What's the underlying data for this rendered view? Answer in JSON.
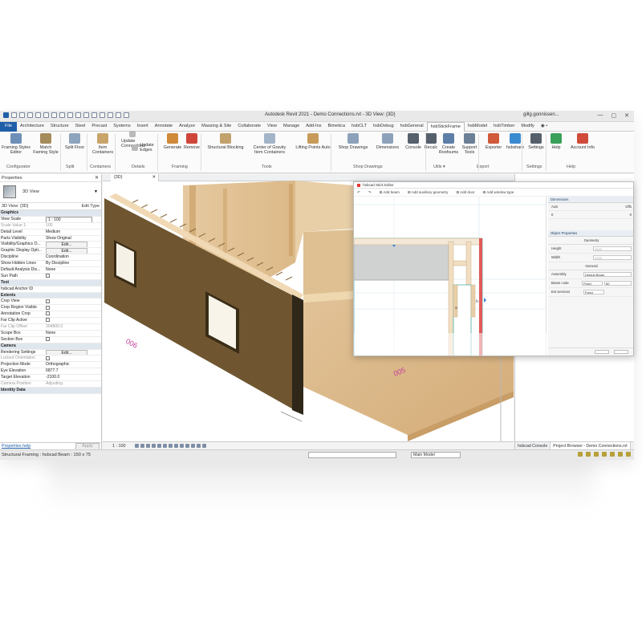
{
  "app": {
    "title": "Autodesk Revit 2021 - Demo Connections.rvt - 3D View: {3D}",
    "user": "gillg.gonnissen...",
    "window_buttons": [
      "—",
      "▢",
      "✕"
    ]
  },
  "ribbon_tabs": [
    {
      "label": "File",
      "state": "file"
    },
    {
      "label": "Architecture"
    },
    {
      "label": "Structure"
    },
    {
      "label": "Steel"
    },
    {
      "label": "Precast"
    },
    {
      "label": "Systems"
    },
    {
      "label": "Insert"
    },
    {
      "label": "Annotate"
    },
    {
      "label": "Analyze"
    },
    {
      "label": "Massing & Site"
    },
    {
      "label": "Collaborate"
    },
    {
      "label": "View"
    },
    {
      "label": "Manage"
    },
    {
      "label": "Add-Ins"
    },
    {
      "label": "Bimetica"
    },
    {
      "label": "hsbCLT"
    },
    {
      "label": "hsbDebug"
    },
    {
      "label": "hsbGeneral"
    },
    {
      "label": "hsbStickFrame",
      "state": "active"
    },
    {
      "label": "hsbModel"
    },
    {
      "label": "hsbTimber"
    },
    {
      "label": "Modify"
    },
    {
      "label": "◉ •"
    }
  ],
  "ribbon": {
    "buttons": [
      {
        "label": "Framing Styles\nEditor",
        "icon": "framing-styles-icon",
        "color": "#6d8fb8"
      },
      {
        "label": "Match\nFaming Style",
        "icon": "match-style-icon",
        "color": "#a58a5a"
      },
      {
        "label": "Split Floor",
        "icon": "split-floor-icon",
        "color": "#8ea4bd"
      },
      {
        "label": "Item\nContainers",
        "icon": "item-containers-icon",
        "color": "#c9a46a"
      },
      {
        "label": "Update\nConnections",
        "icon": "update-connections-icon",
        "color": "#b9b9b9"
      },
      {
        "label": "Update\nEdges",
        "icon": "update-edges-icon",
        "color": "#b9b9b9"
      },
      {
        "label": "Generate",
        "icon": "generate-icon",
        "color": "#d08a3a"
      },
      {
        "label": "Remove",
        "icon": "remove-icon",
        "color": "#d0463a"
      },
      {
        "label": "Structural Blocking",
        "icon": "structural-blocking-icon",
        "color": "#c2a16c"
      },
      {
        "label": "Center of Gravity\nItem Containers",
        "icon": "center-of-gravity-icon",
        "color": "#a3b5c8"
      },
      {
        "label": "Lifting Points Auto",
        "icon": "lifting-points-icon",
        "color": "#c79a5a"
      },
      {
        "label": "Shop Drawings",
        "icon": "shop-drawings-icon",
        "color": "#8da2ba"
      },
      {
        "label": "Dimensions",
        "icon": "dimensions-icon",
        "color": "#8da2ba"
      },
      {
        "label": "Console",
        "icon": "console-icon",
        "color": "#55606c"
      },
      {
        "label": "Recalc",
        "icon": "recalc-icon",
        "color": "#55606c"
      },
      {
        "label": "Create\nRoofsums",
        "icon": "create-roofsums-icon",
        "color": "#5d7ea6"
      },
      {
        "label": "Support\nTools",
        "icon": "support-tools-icon",
        "color": "#6b7f96"
      },
      {
        "label": "Exporter",
        "icon": "exporter-icon",
        "color": "#d05a3a"
      },
      {
        "label": "hsbshare",
        "icon": "hsbshare-icon",
        "color": "#3a8ad0"
      },
      {
        "label": "Settings",
        "icon": "settings-icon",
        "color": "#55606c"
      },
      {
        "label": "Help",
        "icon": "help-icon",
        "color": "#3aa05a"
      },
      {
        "label": "Account Info",
        "icon": "account-info-icon",
        "color": "#d04a3a"
      }
    ],
    "groups": [
      "Configurator",
      "Split",
      "Containers",
      "Details",
      "Framing",
      "Tools",
      "Shop Drawings",
      "Utils ▾",
      "Export",
      "Settings",
      "Help"
    ]
  },
  "properties": {
    "header": "Properties",
    "type_name": "3D View",
    "instance": "3D View: {3D}",
    "edit_type": "Edit Type",
    "rows": [
      {
        "k": "Graphics",
        "cat": true
      },
      {
        "k": "View Scale",
        "v": "1 : 100",
        "field": true
      },
      {
        "k": "Scale Value    1:",
        "v": "100",
        "dim": true
      },
      {
        "k": "Detail Level",
        "v": "Medium"
      },
      {
        "k": "Parts Visibility",
        "v": "Show Original"
      },
      {
        "k": "Visibility/Graphics O...",
        "v": "Edit...",
        "button": true
      },
      {
        "k": "Graphic Display Opti...",
        "v": "Edit...",
        "button": true
      },
      {
        "k": "Discipline",
        "v": "Coordination"
      },
      {
        "k": "Show Hidden Lines",
        "v": "By Discipline"
      },
      {
        "k": "Default Analysis Dis...",
        "v": "None"
      },
      {
        "k": "Sun Path",
        "check": true
      },
      {
        "k": "Text",
        "cat": true
      },
      {
        "k": "hsbcad Anchor ID",
        "v": ""
      },
      {
        "k": "Extents",
        "cat": true
      },
      {
        "k": "Crop View",
        "check": true
      },
      {
        "k": "Crop Region Visible",
        "check": true
      },
      {
        "k": "Annotation Crop",
        "check": true
      },
      {
        "k": "Far Clip Active",
        "check": true
      },
      {
        "k": "Far Clip Offset",
        "v": "304800.0",
        "dim": true
      },
      {
        "k": "Scope Box",
        "v": "None"
      },
      {
        "k": "Section Box",
        "check": true
      },
      {
        "k": "Camera",
        "cat": true
      },
      {
        "k": "Rendering Settings",
        "v": "Edit...",
        "button": true
      },
      {
        "k": "Locked Orientation",
        "dim": true,
        "check": true
      },
      {
        "k": "Projection Mode",
        "v": "Orthographic"
      },
      {
        "k": "Eye Elevation",
        "v": "6877.7"
      },
      {
        "k": "Target Elevation",
        "v": "-2100.0"
      },
      {
        "k": "Camera Position",
        "v": "Adjusting",
        "dim": true
      },
      {
        "k": "Identity Data",
        "cat": true
      }
    ],
    "help_link": "Properties help",
    "apply": "Apply"
  },
  "view": {
    "tab": "{3D}",
    "scale": "1 : 100",
    "grid_labels": [
      "006",
      "005"
    ]
  },
  "dialog": {
    "title": "hsbcad Stick Editor",
    "tools": [
      "↶",
      "↷",
      "⊞ Add beam",
      "⊞ Add auxiliary geometry",
      "⊞ Add door",
      "⊞ Add window type"
    ],
    "sections": {
      "dimensions": "Dimensions",
      "object_properties": "Object Properties",
      "geometry": "Geometry",
      "general": "General"
    },
    "dim_table": {
      "col_a": "Axis",
      "col_b": "Offs",
      "val_a": "0",
      "val_b": "0"
    },
    "geometry_rows": [
      {
        "k": "Height",
        "v": "2500"
      },
      {
        "k": "Width",
        "v": "1000"
      }
    ],
    "general_rows": [
      {
        "k": "Assembly",
        "v": "Default Beam"
      },
      {
        "k": "Beam code",
        "v": "Fixed"
      },
      {
        "k": "Ext services",
        "v": "Fixed"
      }
    ],
    "code_value": "80",
    "marker_labels": [
      "a",
      "b"
    ]
  },
  "browser": {
    "tabs": [
      "hsbcad Console",
      "Project Browser - Demo Connections.rvt"
    ]
  },
  "statusbar": {
    "message": "Structural Framing : hsbcad Beam : 150 x 75",
    "model": "Main Model"
  }
}
